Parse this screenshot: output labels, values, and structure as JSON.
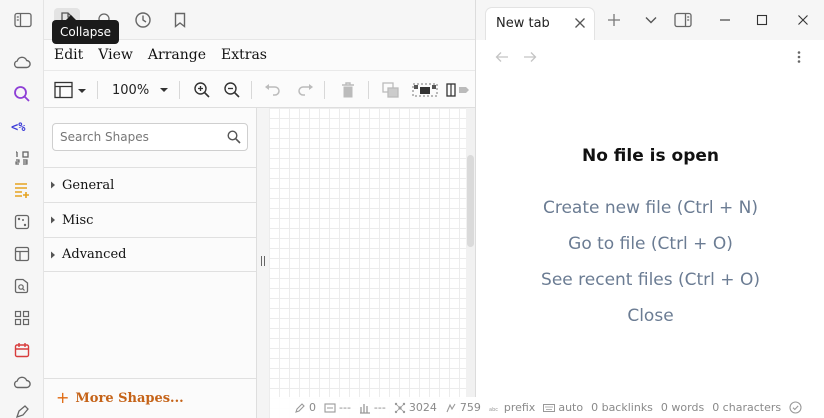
{
  "ribbon": {
    "icons": [
      "cloud-icon",
      "search-icon",
      "code-icon",
      "numbers-icon",
      "calendar-add-icon",
      "graph-icon",
      "layout-icon",
      "image-search-icon",
      "grid-icon",
      "calendar-icon",
      "cloud-icon",
      "pen-icon"
    ],
    "accent_colors": {
      "search": "#8e3fd6",
      "code": "#3c3cd8",
      "calendar_add": "#e5a321",
      "calendar": "#d83c3c"
    }
  },
  "left_top": {
    "icons": [
      "sidebar-toggle-icon",
      "file-icon",
      "search-icon",
      "history-icon",
      "bookmark-icon"
    ],
    "tooltip": "Collapse"
  },
  "menubar": {
    "items": [
      "Edit",
      "View",
      "Arrange",
      "Extras"
    ]
  },
  "toolbar": {
    "zoom": "100%",
    "icons": [
      "page-view-icon",
      "zoom-in-icon",
      "zoom-out-icon",
      "undo-icon",
      "redo-icon",
      "delete-icon",
      "to-front-icon",
      "to-back-icon",
      "format-panel-icon"
    ]
  },
  "sidebar": {
    "search_placeholder": "Search Shapes",
    "sections": [
      "General",
      "Misc",
      "Advanced"
    ],
    "more_shapes": "More Shapes...",
    "more_plus": "+"
  },
  "right_pane": {
    "tab_title": "New tab",
    "empty_title": "No file is open",
    "actions": [
      "Create new file (Ctrl + N)",
      "Go to file (Ctrl + O)",
      "See recent files (Ctrl + O)",
      "Close"
    ],
    "action_color": "#6b7c93"
  },
  "statusbar": {
    "items": [
      "0",
      "---",
      "---",
      "3024",
      "759",
      "prefix",
      "auto",
      "0 backlinks",
      "0 words",
      "0 characters"
    ]
  }
}
